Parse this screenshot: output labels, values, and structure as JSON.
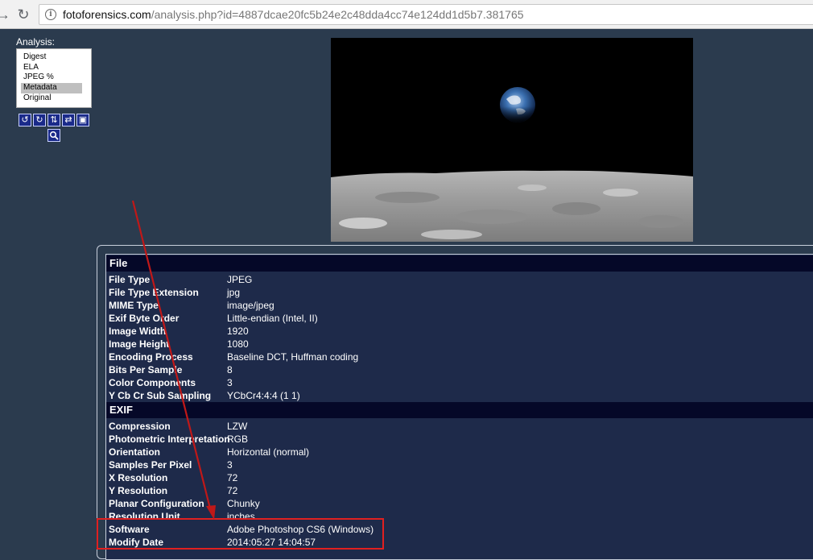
{
  "browser": {
    "url_host": "fotoforensics.com",
    "url_path": "/analysis.php?id=4887dcae20fc5b24e2c48dda4cc74e124dd1d5b7.381765"
  },
  "sidebar": {
    "label": "Analysis:",
    "items": [
      {
        "label": "Digest"
      },
      {
        "label": "ELA"
      },
      {
        "label": "JPEG %"
      },
      {
        "label": "Metadata"
      },
      {
        "label": "Original"
      }
    ],
    "selected": "Metadata",
    "tools": [
      "rotate-left-icon",
      "rotate-right-icon",
      "flip-vertical-icon",
      "flip-horizontal-icon",
      "fit-icon",
      "zoom-icon"
    ]
  },
  "metadata": {
    "file_title": "File",
    "file_rows": [
      {
        "key": "File Type",
        "value": "JPEG"
      },
      {
        "key": "File Type Extension",
        "value": "jpg"
      },
      {
        "key": "MIME Type",
        "value": "image/jpeg"
      },
      {
        "key": "Exif Byte Order",
        "value": "Little-endian (Intel, II)"
      },
      {
        "key": "Image Width",
        "value": "1920"
      },
      {
        "key": "Image Height",
        "value": "1080"
      },
      {
        "key": "Encoding Process",
        "value": "Baseline DCT, Huffman coding"
      },
      {
        "key": "Bits Per Sample",
        "value": "8"
      },
      {
        "key": "Color Components",
        "value": "3"
      },
      {
        "key": "Y Cb Cr Sub Sampling",
        "value": "YCbCr4:4:4 (1 1)"
      }
    ],
    "exif_title": "EXIF",
    "exif_rows": [
      {
        "key": "Compression",
        "value": "LZW"
      },
      {
        "key": "Photometric Interpretation",
        "value": "RGB"
      },
      {
        "key": "Orientation",
        "value": "Horizontal (normal)"
      },
      {
        "key": "Samples Per Pixel",
        "value": "3"
      },
      {
        "key": "X Resolution",
        "value": "72"
      },
      {
        "key": "Y Resolution",
        "value": "72"
      },
      {
        "key": "Planar Configuration",
        "value": "Chunky"
      },
      {
        "key": "Resolution Unit",
        "value": "inches"
      },
      {
        "key": "Software",
        "value": "Adobe Photoshop CS6 (Windows)"
      },
      {
        "key": "Modify Date",
        "value": "2014:05:27 14:04:57"
      }
    ]
  },
  "annotation_color": "#e02020"
}
